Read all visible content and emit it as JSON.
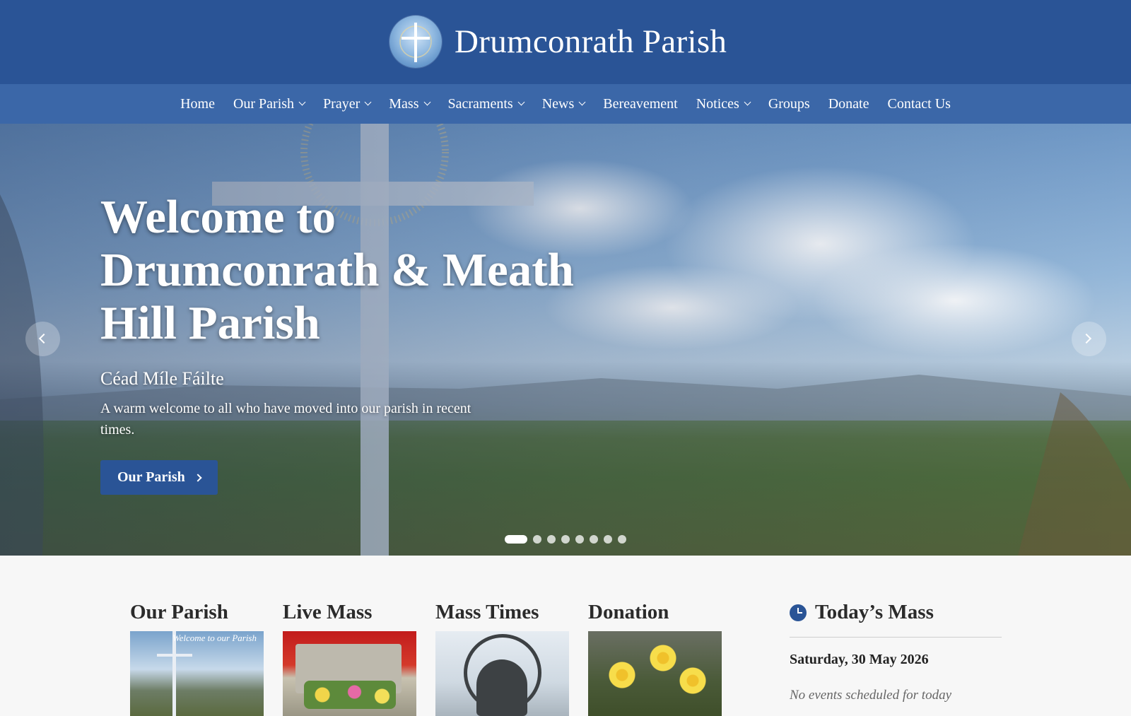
{
  "header": {
    "site_name": "Drumconrath Parish"
  },
  "nav": {
    "items": [
      {
        "label": "Home",
        "dropdown": false
      },
      {
        "label": "Our Parish",
        "dropdown": true
      },
      {
        "label": "Prayer",
        "dropdown": true
      },
      {
        "label": "Mass",
        "dropdown": true
      },
      {
        "label": "Sacraments",
        "dropdown": true
      },
      {
        "label": "News",
        "dropdown": true
      },
      {
        "label": "Bereavement",
        "dropdown": false
      },
      {
        "label": "Notices",
        "dropdown": true
      },
      {
        "label": "Groups",
        "dropdown": false
      },
      {
        "label": "Donate",
        "dropdown": false
      },
      {
        "label": "Contact Us",
        "dropdown": false
      }
    ]
  },
  "hero": {
    "title": "Welcome to Drumconrath & Meath Hill Parish",
    "subtitle": "Céad Míle Fáilte",
    "description": "A warm welcome to all who have moved into our parish in recent times.",
    "button_label": "Our Parish",
    "slide_count": 8,
    "active_slide": 1
  },
  "cards": [
    {
      "title": "Our Parish",
      "image_caption": "Welcome to our Parish"
    },
    {
      "title": "Live Mass"
    },
    {
      "title": "Mass Times"
    },
    {
      "title": "Donation"
    }
  ],
  "sidebar": {
    "title": "Today’s Mass",
    "date": "Saturday, 30 May 2026",
    "empty_text": "No events scheduled for today"
  },
  "colors": {
    "header_bg": "#2a5496",
    "nav_bg": "#3b67a8",
    "accent": "#2a5496"
  }
}
